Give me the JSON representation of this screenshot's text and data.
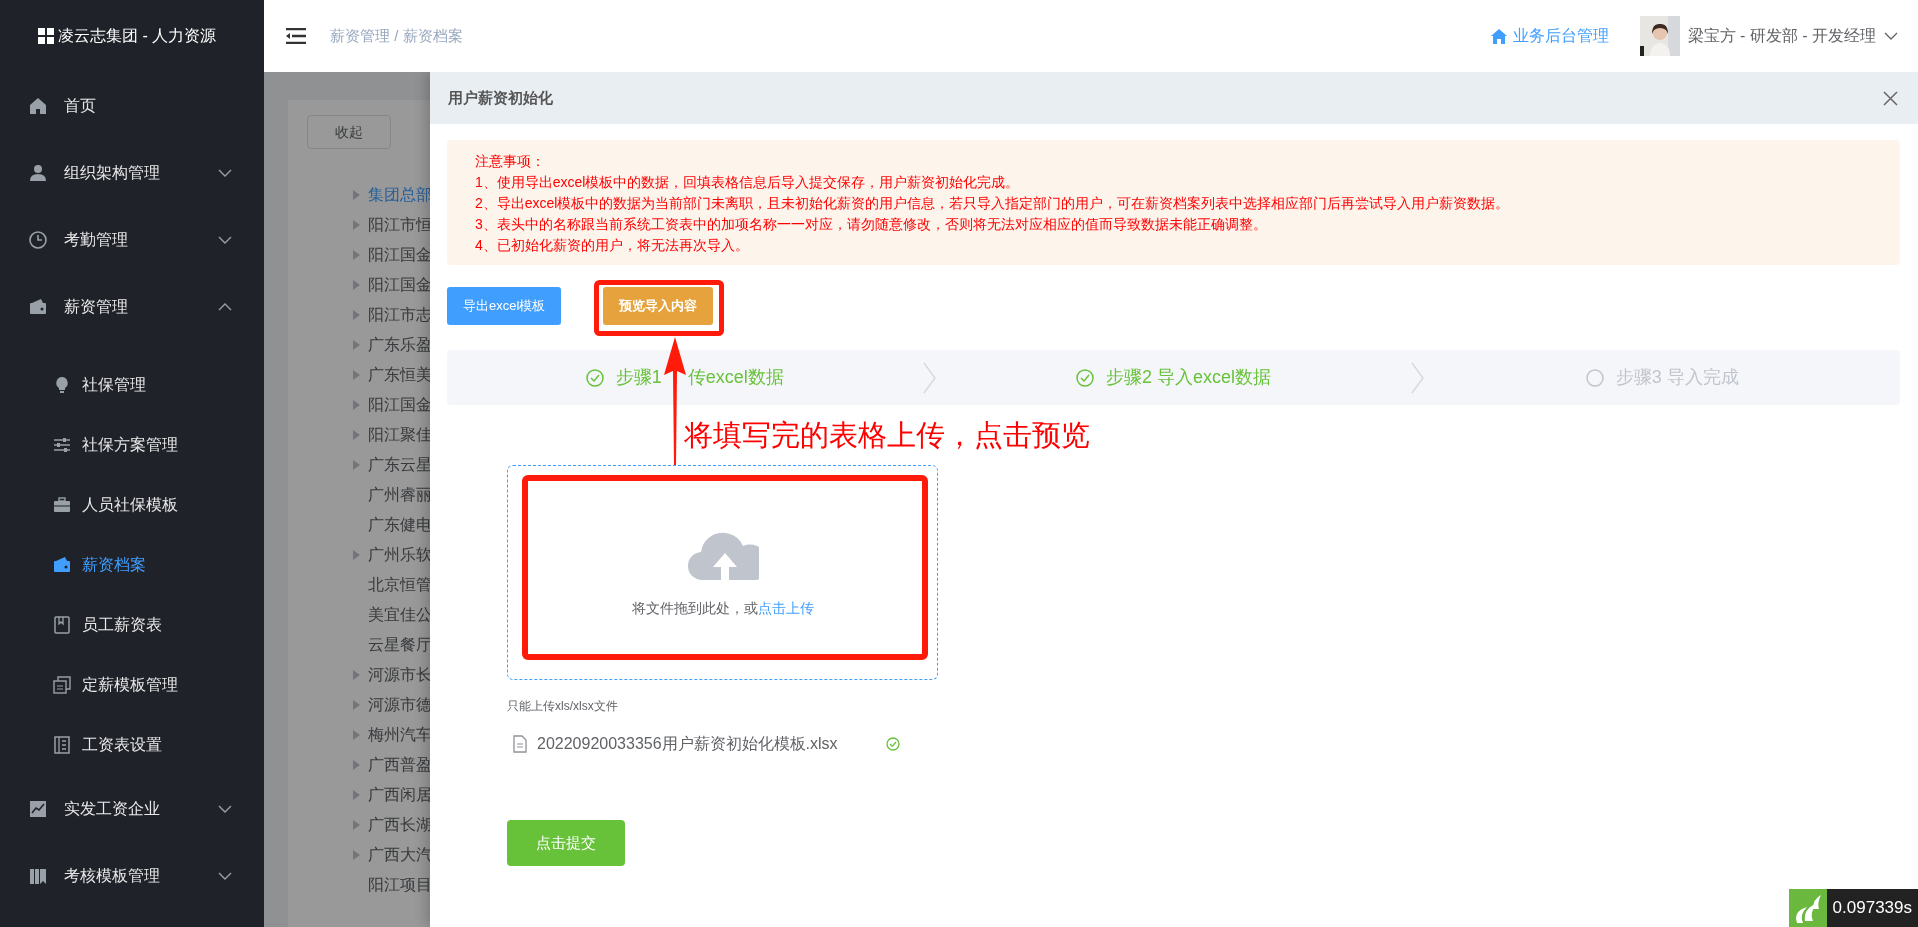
{
  "sidebar": {
    "logo": "凌云志集团 - 人力资源",
    "items": [
      {
        "label": "首页",
        "kind": "leaf"
      },
      {
        "label": "组织架构管理",
        "kind": "group",
        "expanded": false
      },
      {
        "label": "考勤管理",
        "kind": "group",
        "expanded": false
      },
      {
        "label": "薪资管理",
        "kind": "group",
        "expanded": true,
        "children": [
          {
            "label": "社保管理",
            "selected": false
          },
          {
            "label": "社保方案管理",
            "selected": false
          },
          {
            "label": "人员社保模板",
            "selected": false
          },
          {
            "label": "薪资档案",
            "selected": true
          },
          {
            "label": "员工薪资表",
            "selected": false
          },
          {
            "label": "定薪模板管理",
            "selected": false
          },
          {
            "label": "工资表设置",
            "selected": false
          }
        ]
      },
      {
        "label": "实发工资企业",
        "kind": "group",
        "expanded": false
      },
      {
        "label": "考核模板管理",
        "kind": "group",
        "expanded": false
      }
    ]
  },
  "header": {
    "breadcrumb": "薪资管理 / 薪资档案",
    "link": "业务后台管理",
    "user": "梁宝方 - 研发部 - 开发经理"
  },
  "background": {
    "collapse_button": "收起",
    "tree": [
      {
        "label": "集团总部",
        "has_children": true,
        "selected": true
      },
      {
        "label": "阳江市恒",
        "has_children": true,
        "selected": false
      },
      {
        "label": "阳江国金",
        "has_children": true,
        "selected": false
      },
      {
        "label": "阳江国金",
        "has_children": true,
        "selected": false
      },
      {
        "label": "阳江市志",
        "has_children": true,
        "selected": false
      },
      {
        "label": "广东乐盈",
        "has_children": true,
        "selected": false
      },
      {
        "label": "广东恒美",
        "has_children": true,
        "selected": false
      },
      {
        "label": "阳江国金",
        "has_children": true,
        "selected": false
      },
      {
        "label": "阳江聚佳",
        "has_children": true,
        "selected": false
      },
      {
        "label": "广东云星",
        "has_children": true,
        "selected": false
      },
      {
        "label": "广州睿丽",
        "has_children": false,
        "selected": false
      },
      {
        "label": "广东健电",
        "has_children": false,
        "selected": false
      },
      {
        "label": "广州乐软",
        "has_children": true,
        "selected": false
      },
      {
        "label": "北京恒管",
        "has_children": false,
        "selected": false
      },
      {
        "label": "美宜佳公",
        "has_children": false,
        "selected": false
      },
      {
        "label": "云星餐厅",
        "has_children": false,
        "selected": false
      },
      {
        "label": "河源市长",
        "has_children": true,
        "selected": false
      },
      {
        "label": "河源市德",
        "has_children": true,
        "selected": false
      },
      {
        "label": "梅州汽车",
        "has_children": true,
        "selected": false
      },
      {
        "label": "广西普盈",
        "has_children": true,
        "selected": false
      },
      {
        "label": "广西闲居",
        "has_children": true,
        "selected": false
      },
      {
        "label": "广西长湖",
        "has_children": true,
        "selected": false
      },
      {
        "label": "广西大汽",
        "has_children": true,
        "selected": false
      },
      {
        "label": "阳江项目",
        "has_children": false,
        "selected": false
      }
    ]
  },
  "drawer": {
    "title": "用户薪资初始化",
    "notice": {
      "heading": "注意事项：",
      "lines": [
        "1、使用导出excel模板中的数据，回填表格信息后导入提交保存，用户薪资初始化完成。",
        "2、导出excel模板中的数据为当前部门未离职，且未初始化薪资的用户信息，若只导入指定部门的用户，可在薪资档案列表中选择相应部门后再尝试导入用户薪资数据。",
        "3、表头中的名称跟当前系统工资表中的加项名称一一对应，请勿随意修改，否则将无法对应相应的值而导致数据未能正确调整。",
        "4、已初始化薪资的用户，将无法再次导入。"
      ]
    },
    "buttons": [
      {
        "label": "导出excel模板",
        "kind": "primary"
      },
      {
        "label": "预览导入内容",
        "kind": "warning"
      }
    ],
    "steps": [
      {
        "parts": [
          "步骤1",
          "传excel数据"
        ],
        "done": true
      },
      {
        "parts": [
          "步骤2 导入excel数据"
        ],
        "done": true
      },
      {
        "parts": [
          "步骤3 导入完成"
        ],
        "done": false
      }
    ],
    "upload": {
      "text": "将文件拖到此处，或",
      "link": "点击上传",
      "hint": "只能上传xls/xlsx文件",
      "files": [
        {
          "name": "20220920033356用户薪资初始化模板.xlsx",
          "uploaded": true
        }
      ]
    },
    "submit": "点击提交"
  },
  "annotation": {
    "text": "将填写完的表格上传，点击预览"
  },
  "timer": {
    "value": "0.097339s"
  }
}
